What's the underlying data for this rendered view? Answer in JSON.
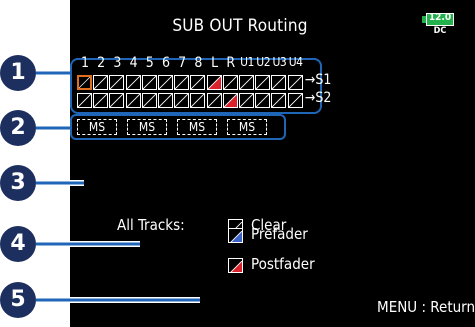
{
  "header": {
    "title": "SUB OUT Routing",
    "battery_value": "12.0",
    "battery_label": "DC",
    "battery_color": "#22b14c"
  },
  "tracks": [
    "1",
    "2",
    "3",
    "4",
    "5",
    "6",
    "7",
    "8",
    "L",
    "R",
    "U1",
    "U2",
    "U3",
    "U4"
  ],
  "outputs": [
    {
      "label": "S1",
      "arrow": "→",
      "states": [
        "none",
        "none",
        "none",
        "none",
        "none",
        "none",
        "none",
        "none",
        "postfader",
        "none",
        "none",
        "none",
        "none",
        "none"
      ]
    },
    {
      "label": "S2",
      "arrow": "→",
      "states": [
        "none",
        "none",
        "none",
        "none",
        "none",
        "none",
        "none",
        "none",
        "none",
        "postfader",
        "none",
        "none",
        "none",
        "none"
      ]
    }
  ],
  "cursor": {
    "row": 0,
    "col": 0,
    "color": "#e0701e"
  },
  "ms_labels": [
    "MS",
    "MS",
    "MS",
    "MS"
  ],
  "legend": {
    "all_tracks_label": "All Tracks:",
    "clear_label": "Clear",
    "prefader_label": "Prefader",
    "postfader_label": "Postfader"
  },
  "footer": {
    "hint": "MENU : Return"
  },
  "callouts": [
    "1",
    "2",
    "3",
    "4",
    "5"
  ],
  "colors": {
    "postfader": "#d9222b",
    "prefader": "#3a64c8",
    "callout_line": "#1f66b8",
    "callout_badge": "#1c2f5e"
  }
}
